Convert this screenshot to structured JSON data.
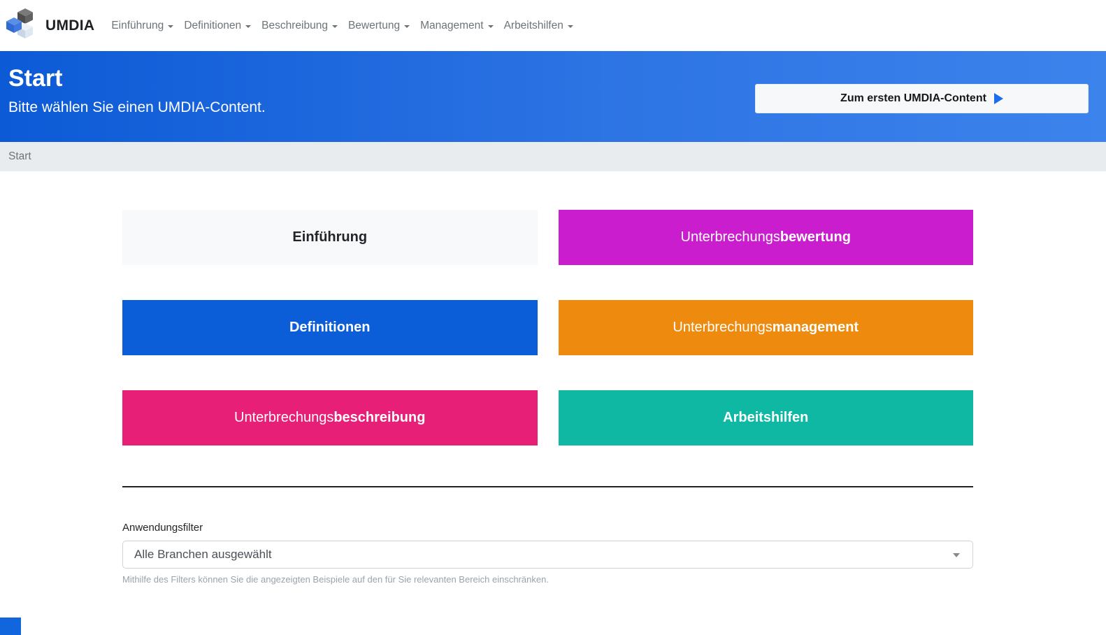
{
  "brand": {
    "title": "UMDIA",
    "logo_icon": "cube-logo"
  },
  "navbar": {
    "items": [
      {
        "label": "Einführung"
      },
      {
        "label": "Definitionen"
      },
      {
        "label": "Beschreibung"
      },
      {
        "label": "Bewertung"
      },
      {
        "label": "Management"
      },
      {
        "label": "Arbeitshilfen"
      }
    ]
  },
  "hero": {
    "title": "Start",
    "subtitle": "Bitte wählen Sie einen UMDIA-Content.",
    "cta": {
      "label": "Zum ersten UMDIA-Content",
      "icon": "play-icon"
    },
    "bg_gradient": [
      "#0c5ad6",
      "#3d83ec"
    ]
  },
  "breadcrumb": {
    "current": "Start"
  },
  "tiles": [
    {
      "name": "tile-einfuehrung",
      "prefix": "",
      "label": "Einführung",
      "bg": "#f8f9fa",
      "color": "#212529"
    },
    {
      "name": "tile-unterbrechungsbewertung",
      "prefix": "Unterbrechungs",
      "label": "bewertung",
      "bg": "#ca1dcd",
      "color": "#ffffff"
    },
    {
      "name": "tile-definitionen",
      "prefix": "",
      "label": "Definitionen",
      "bg": "#0b5ed7",
      "color": "#ffffff"
    },
    {
      "name": "tile-unterbrechungsmanagement",
      "prefix": "Unterbrechungs",
      "label": "management",
      "bg": "#ee8b0e",
      "color": "#ffffff"
    },
    {
      "name": "tile-unterbrechungsbeschreibung",
      "prefix": "Unterbrechungs",
      "label": "beschreibung",
      "bg": "#e81f76",
      "color": "#ffffff"
    },
    {
      "name": "tile-arbeitshilfen",
      "prefix": "",
      "label": "Arbeitshilfen",
      "bg": "#0fb8a3",
      "color": "#ffffff"
    }
  ],
  "filter": {
    "label": "Anwendungsfilter",
    "select_value": "Alle Branchen ausgewählt",
    "help_text": "Mithilfe des Filters können Sie die angezeigten Beispiele auf den für Sie relevanten Bereich einschränken."
  },
  "colors": {
    "primary_blue": "#0b5ed7",
    "hero_gradient_start": "#0c5ad6",
    "hero_gradient_end": "#3d83ec",
    "magenta": "#ca1dcd",
    "orange": "#ee8b0e",
    "pink": "#e81f76",
    "teal": "#0fb8a3",
    "tile_light": "#f8f9fa",
    "breadcrumb_bg": "#e9ecef"
  }
}
